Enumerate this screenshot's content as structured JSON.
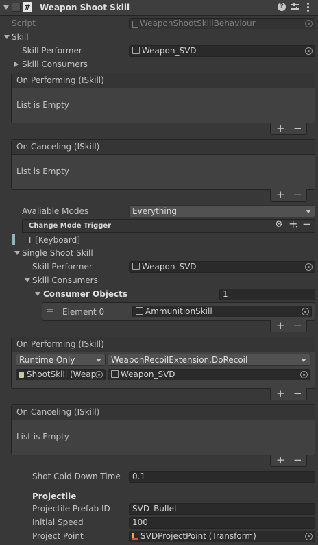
{
  "header": {
    "title": "Weapon Shoot Skill",
    "icons": [
      "help-icon",
      "preset-icon",
      "more-menu-icon"
    ]
  },
  "script": {
    "label": "Script",
    "value": "WeaponShootSkillBehaviour"
  },
  "skill": {
    "label": "Skill",
    "performer_label": "Skill Performer",
    "performer_value": "Weapon_SVD",
    "consumers_label": "Skill Consumers",
    "on_performing": {
      "title": "On Performing (ISkill)",
      "empty": "List is Empty"
    },
    "on_canceling": {
      "title": "On Canceling (ISkill)",
      "empty": "List is Empty"
    }
  },
  "modes": {
    "label": "Avaliable Modes",
    "value": "Everything"
  },
  "change_mode": {
    "title": "Change Mode Trigger",
    "item": "T [Keyboard]"
  },
  "single": {
    "label": "Single Shoot Skill",
    "performer_label": "Skill Performer",
    "performer_value": "Weapon_SVD",
    "consumers_label": "Skill Consumers",
    "consumer_objects_label": "Consumer Objects",
    "consumer_objects_count": "1",
    "element_label": "Element 0",
    "element_value": "AmmunitionSkill",
    "on_performing": {
      "title": "On Performing (ISkill)",
      "runtime": "Runtime Only",
      "function": "WeaponRecoilExtension.DoRecoil",
      "target": "ShootSkill (Weap",
      "argument": "Weapon_SVD"
    },
    "on_canceling": {
      "title": "On Canceling (ISkill)",
      "empty": "List is Empty"
    },
    "cold_label": "Shot Cold Down Time",
    "cold_value": "0.1"
  },
  "projectile": {
    "header": "Projectile",
    "prefab_label": "Projectile Prefab ID",
    "prefab_value": "SVD_Bullet",
    "speed_label": "Initial Speed",
    "speed_value": "100",
    "point_label": "Project Point",
    "point_value": "SVDProjectPoint (Transform)"
  },
  "list_buttons": {
    "add": "+",
    "remove": "−"
  },
  "colors": {
    "background": "#383838",
    "field": "#2a2a2a",
    "box": "#414141",
    "selection_marker": "#8fb3c4"
  }
}
